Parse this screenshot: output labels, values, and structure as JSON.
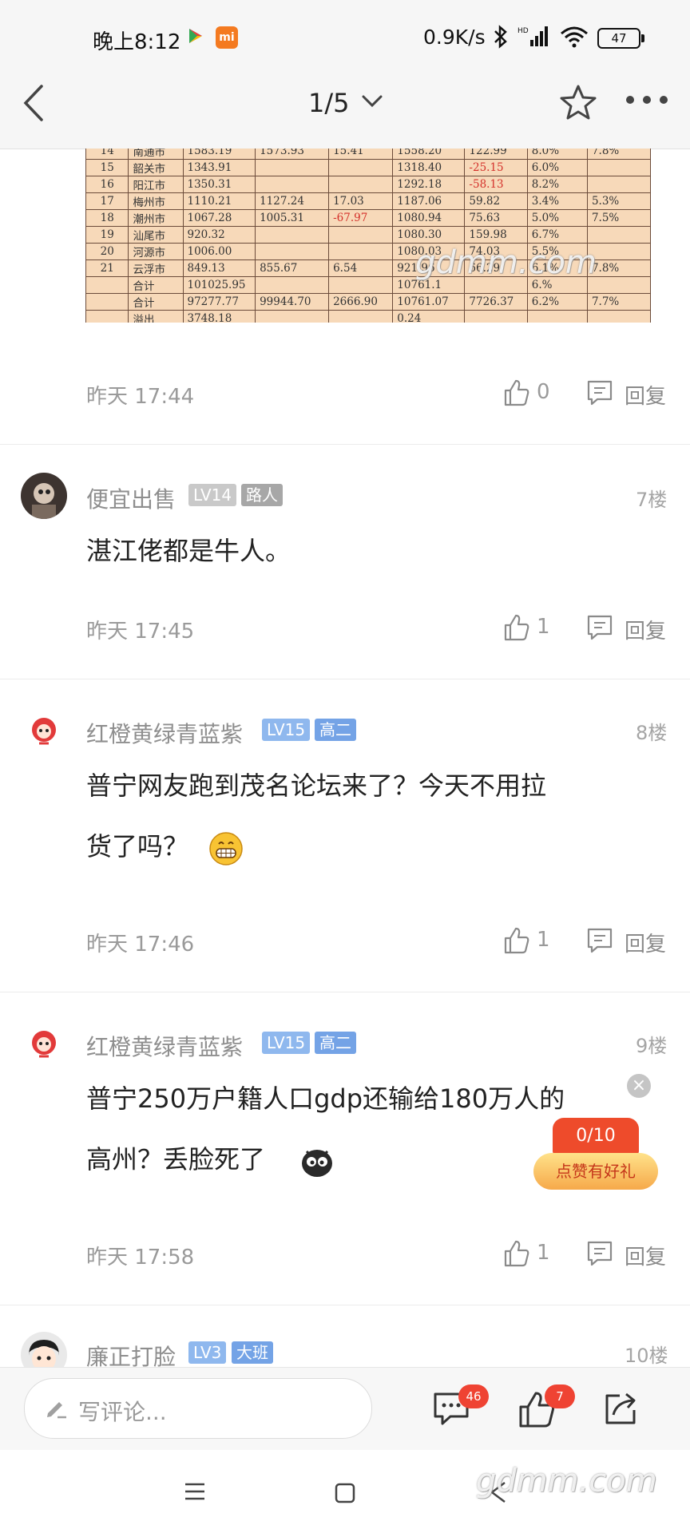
{
  "status_bar": {
    "time": "晚上8:12",
    "net_speed": "0.9K/s",
    "battery": "47",
    "mi_label": "mi"
  },
  "header": {
    "page_indicator": "1/5"
  },
  "image_table": {
    "rows": [
      [
        "14",
        "南通市",
        "1583.19",
        "1573.93",
        "15.41",
        "1558.20",
        "122.99",
        "8.0%",
        "7.8%"
      ],
      [
        "15",
        "韶关市",
        "1343.91",
        "",
        "",
        "1318.40",
        "-25.15",
        "6.0%",
        ""
      ],
      [
        "16",
        "阳江市",
        "1350.31",
        "",
        "",
        "1292.18",
        "-58.13",
        "8.2%",
        ""
      ],
      [
        "17",
        "梅州市",
        "1110.21",
        "1127.24",
        "17.03",
        "1187.06",
        "59.82",
        "3.4%",
        "5.3%"
      ],
      [
        "18",
        "潮州市",
        "1067.28",
        "1005.31",
        "-67.97",
        "1080.94",
        "75.63",
        "5.0%",
        "7.5%"
      ],
      [
        "19",
        "汕尾市",
        "920.32",
        "",
        "",
        "1080.30",
        "159.98",
        "6.7%",
        ""
      ],
      [
        "20",
        "河源市",
        "1006.00",
        "",
        "",
        "1080.03",
        "74.03",
        "5.5%",
        ""
      ],
      [
        "21",
        "云浮市",
        "849.13",
        "855.67",
        "6.54",
        "921.96",
        "66.29",
        "6.1%",
        "7.8%"
      ],
      [
        "",
        "合计",
        "101025.95",
        "",
        "",
        "10761.1",
        "",
        "6.%",
        ""
      ],
      [
        "",
        "合计",
        "97277.77",
        "99944.70",
        "2666.90",
        "10761.07",
        "7726.37",
        "6.2%",
        "7.7%"
      ],
      [
        "",
        "溢出",
        "3748.18",
        "",
        "",
        "0.24",
        "",
        "",
        ""
      ]
    ]
  },
  "watermark": "gdmm.com",
  "comments": [
    {
      "time": "昨天 17:44",
      "likes": "0",
      "reply_label": "回复"
    },
    {
      "username": "便宜出售",
      "level": "LV14",
      "tag": "路人",
      "floor": "7楼",
      "content": "湛江佬都是牛人。",
      "time": "昨天 17:45",
      "likes": "1",
      "reply_label": "回复"
    },
    {
      "username": "红橙黄绿青蓝紫",
      "level": "LV15",
      "tag": "高二",
      "floor": "8楼",
      "content_line1": "普宁网友跑到茂名论坛来了？今天不用拉",
      "content_line2": "货了吗？",
      "time": "昨天 17:46",
      "likes": "1",
      "reply_label": "回复"
    },
    {
      "username": "红橙黄绿青蓝紫",
      "level": "LV15",
      "tag": "高二",
      "floor": "9楼",
      "content_line1": "普宁250万户籍人口gdp还输给180万人的",
      "content_line2": "高州？丢脸死了",
      "time": "昨天 17:58",
      "likes": "1",
      "reply_label": "回复"
    },
    {
      "username": "廉正打脸",
      "level": "LV3",
      "tag": "大班",
      "floor": "10楼"
    }
  ],
  "promo": {
    "progress": "0/10",
    "label": "点赞有好礼",
    "close": "×"
  },
  "bottom_bar": {
    "input_placeholder": "写评论...",
    "comment_count": "46",
    "like_count": "7"
  }
}
